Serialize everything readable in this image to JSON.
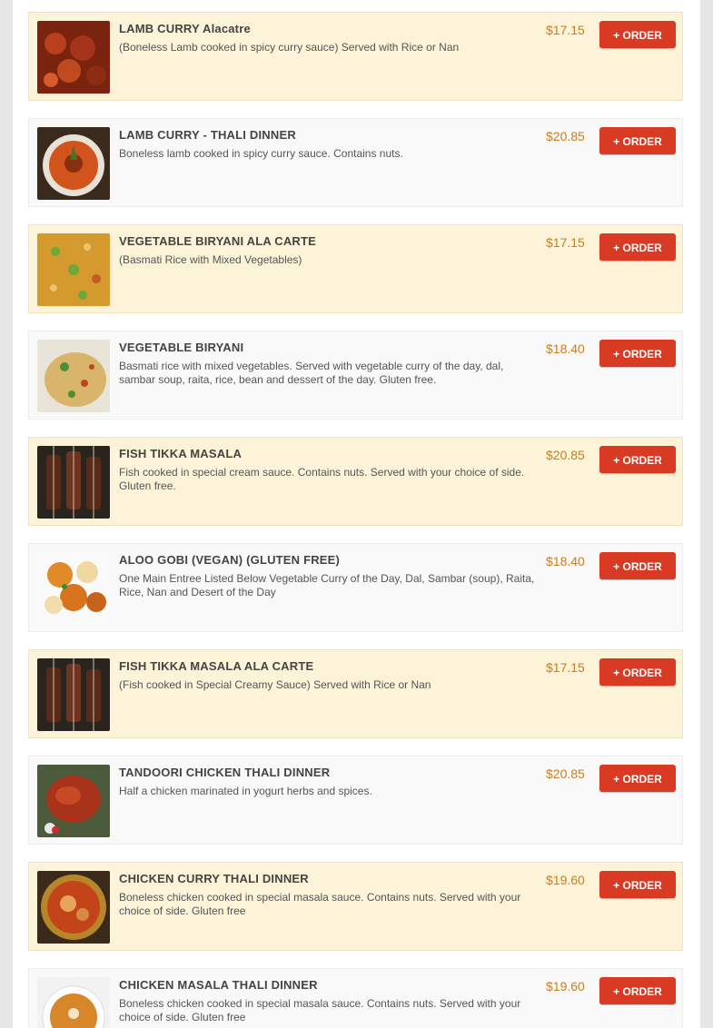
{
  "menu": {
    "order_label": "+ ORDER",
    "items": [
      {
        "title": "LAMB CURRY Alacatre",
        "desc": "(Boneless Lamb cooked in spicy curry sauce) Served with Rice or Nan",
        "price": "$17.15"
      },
      {
        "title": "LAMB CURRY - THALI DINNER",
        "desc": "Boneless lamb cooked in spicy curry sauce. Contains nuts.",
        "price": "$20.85"
      },
      {
        "title": "VEGETABLE BIRYANI ALA CARTE",
        "desc": "(Basmati Rice with Mixed Vegetables)",
        "price": "$17.15"
      },
      {
        "title": "VEGETABLE BIRYANI",
        "desc": "Basmati rice with mixed vegetables. Served with vegetable curry of the day, dal, sambar soup, raita, rice, bean and dessert of the day. Gluten free.",
        "price": "$18.40"
      },
      {
        "title": "FISH TIKKA MASALA",
        "desc": "Fish cooked in special cream sauce. Contains nuts. Served with your choice of side. Gluten free.",
        "price": "$20.85"
      },
      {
        "title": "ALOO GOBI (VEGAN) (GLUTEN FREE)",
        "desc": "One Main Entree Listed Below Vegetable Curry of the Day, Dal, Sambar (soup), Raita, Rice, Nan and Desert of the Day",
        "price": "$18.40"
      },
      {
        "title": "FISH TIKKA MASALA ALA CARTE",
        "desc": "(Fish cooked in Special Creamy Sauce) Served with Rice or Nan",
        "price": "$17.15"
      },
      {
        "title": "TANDOORI CHICKEN THALI DINNER",
        "desc": "Half a chicken marinated in yogurt herbs and spices.",
        "price": "$20.85"
      },
      {
        "title": "CHICKEN CURRY THALI DINNER",
        "desc": "Boneless chicken cooked in special masala sauce. Contains nuts. Served with your choice of side. Gluten free",
        "price": "$19.60"
      },
      {
        "title": "CHICKEN MASALA THALI DINNER",
        "desc": "Boneless chicken cooked in special masala sauce. Contains nuts. Served with your choice of side. Gluten free",
        "price": "$19.60"
      }
    ]
  }
}
